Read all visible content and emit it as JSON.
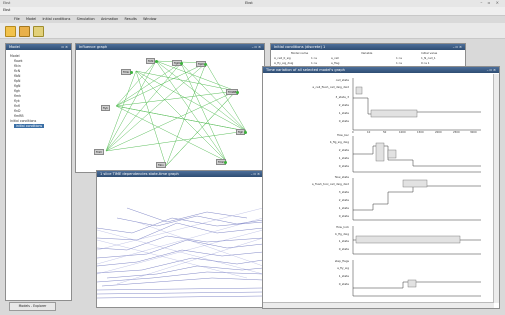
{
  "window": {
    "title": "Ebst",
    "app_label": "Ebst"
  },
  "menu": [
    "File",
    "Model",
    "Initial conditions",
    "Simulation",
    "Animation",
    "Results",
    "Window"
  ],
  "toolbar": {
    "icons": [
      "new-icon",
      "open-icon",
      "save-icon"
    ]
  },
  "explorer": {
    "title": "Model",
    "items": [
      "Model",
      "flowk",
      "flkin",
      "flcN",
      "flbN",
      "flpN",
      "flgN",
      "flgh",
      "flmh",
      "flyk",
      "flnfI",
      "flnD",
      "flmRB"
    ],
    "section": "Initial conditions",
    "selected": "initial conditions",
    "tab_label": "Models - Explorer"
  },
  "network": {
    "title": "Influence graph",
    "nodes": [
      "flcN",
      "flgN",
      "flpN",
      "flmk",
      "flmRB",
      "flyk",
      "flgh",
      "flnD",
      "flmh",
      "flkin"
    ]
  },
  "conditions": {
    "title": "Initial conditions (discrete) 1",
    "columns": [
      "Model name",
      "Variable",
      "Initial value"
    ],
    "rows": [
      [
        "A_cell_0_sig",
        "1 ns",
        "a_cell",
        "1 ns",
        "1_N_cell_1"
      ],
      [
        "A_fly_sig_dsig",
        "1 ns",
        "a_flag",
        "1 ns",
        "0 ns 1"
      ]
    ]
  },
  "dynamics": {
    "title": "1 slice  TIME dependencies  state-time  graph",
    "subtitle": "1 slice  TIME dependencies  state-time  graph"
  },
  "timeplot": {
    "title": "Time variation of all selected model's graph",
    "x_ticks": [
      "0",
      "10",
      "50",
      "1000",
      "1500",
      "2000",
      "2500",
      "3000"
    ],
    "groups": [
      {
        "labels": [
          "cell_state",
          "a_cell_flush_cell_dsig_dsid",
          "",
          "",
          "3_state_3",
          "2_state",
          "1_state",
          "0_state",
          "n_"
        ],
        "marker": "1"
      },
      {
        "labels": [
          "flow_bsc",
          "b_flg_sig_dsig",
          "2_state",
          "1_state",
          "0_state",
          "n_"
        ],
        "marker": "1"
      },
      {
        "labels": [
          "flow_state",
          "a_flush_tool_cell_dsig_dsid",
          "3_state",
          "2_state",
          "1_state",
          "0_state",
          "n_"
        ],
        "marker": "2"
      },
      {
        "labels": [
          "flow_lock",
          "b_flg_dsig",
          "1_state",
          "0_state",
          "n_"
        ],
        "marker": "0"
      },
      {
        "labels": [
          "step_flags",
          "a_fly_sig",
          "1_state",
          "0_state",
          "n_"
        ],
        "marker": "1"
      }
    ]
  },
  "colors": {
    "titlebar": "#2f4d73",
    "graph_node": "#3cb13c",
    "edge": "#5cbf5c",
    "dyn_line": "#5b63b5"
  }
}
